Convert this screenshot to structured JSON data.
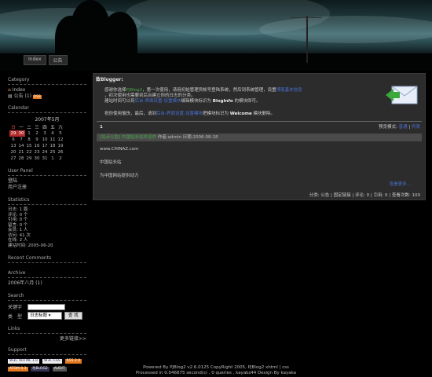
{
  "nav": {
    "items": [
      "Index",
      "公告"
    ]
  },
  "sidebar": {
    "category_title": "Category",
    "category_items": [
      "Index",
      "公告"
    ],
    "category_count": "(1)",
    "rss_label": "RSS",
    "calendar_title": "Calendar",
    "calendar_month": "2007年5月",
    "calendar_weekdays": [
      "日",
      "一",
      "二",
      "三",
      "四",
      "五",
      "六"
    ],
    "calendar_rows": [
      [
        "29",
        "30",
        "1",
        "2",
        "3",
        "4",
        "5"
      ],
      [
        "6",
        "7",
        "8",
        "9",
        "10",
        "11",
        "12"
      ],
      [
        "13",
        "14",
        "15",
        "16",
        "17",
        "18",
        "19"
      ],
      [
        "20",
        "21",
        "22",
        "23",
        "24",
        "25",
        "26"
      ],
      [
        "27",
        "28",
        "29",
        "30",
        "31",
        "1",
        "2"
      ]
    ],
    "user_panel_title": "User Panel",
    "user_panel_items": [
      "登陆",
      "用户注册"
    ],
    "statistics_title": "Statistics",
    "statistics_items": [
      "日志: 1 篇",
      "评论: 0 个",
      "引用: 0 个",
      "留言: 0 个",
      "会员: 1 人",
      "访问: 41 次",
      "在线: 2 人",
      "建站时间: 2005-06-20"
    ],
    "recent_comments_title": "Recent Comments",
    "archive_title": "Archive",
    "archive_item": "2006年八月 (1)",
    "search_title": "Search",
    "search_keyword_label": "关键字",
    "search_type_label": "类　型",
    "search_type_value": "日志标题",
    "search_button": "查 找",
    "links_title": "Links",
    "links_more": "更多链接>>",
    "support_title": "Support",
    "support_badges": [
      "W3C XHTML 1.0",
      "W3C CSS",
      "RSS 2.0",
      "ATOM 0.3",
      "PJBLOG2",
      "AUDIT"
    ]
  },
  "main": {
    "header": "致Blogger:",
    "intro_1a": "感谢你选择",
    "intro_1b": "PJBlog2",
    "intro_1c": "，第一次使用，请用初始管理员帐号登陆系统，然后到系统管理，设置",
    "intro_1d": "博客基本信息",
    "intro_2": "，初次使用也需要到后台建立你的日志的分类。",
    "intro_3a": "建站时间可以到",
    "intro_3b": "后台-界面设置-设置模块",
    "intro_3c": "编辑模块标识为",
    "intro_3d": "BlogInfo",
    "intro_3e": "的模块即可。",
    "intro_4a": "祝你使用愉快，最后，请到",
    "intro_4b": "后台-界面设置-设置模块",
    "intro_4c": "把模块标识为",
    "intro_4d": "Welcome",
    "intro_4e": "模块删除。",
    "page_num": "1",
    "preview_mode_label": "预览模式:",
    "preview_mode_normal": "普通",
    "preview_mode_list": "列表",
    "post_title": "[站点公告] 中国站长站欢迎你",
    "post_meta": "作者:admin 日期:2006-08-18",
    "post_line_1": "www.CHINAZ.com",
    "post_line_2": "中国站长站",
    "post_line_3": "为中国网站提供动力",
    "read_more": "查看更多...",
    "post_footer": "分类: 公告 | 固定链接 | 评论: 0 | 引用: 0 | 查看次数: 100"
  },
  "footer": {
    "line_1": "Powered By PJBlog2 v2.6.0125 CopyRight 2005, PJBlog2 xhtml | css",
    "line_2": "Processed in 0.046875 second(s) , 0 queries , kayaks44 Design By kayaka"
  }
}
